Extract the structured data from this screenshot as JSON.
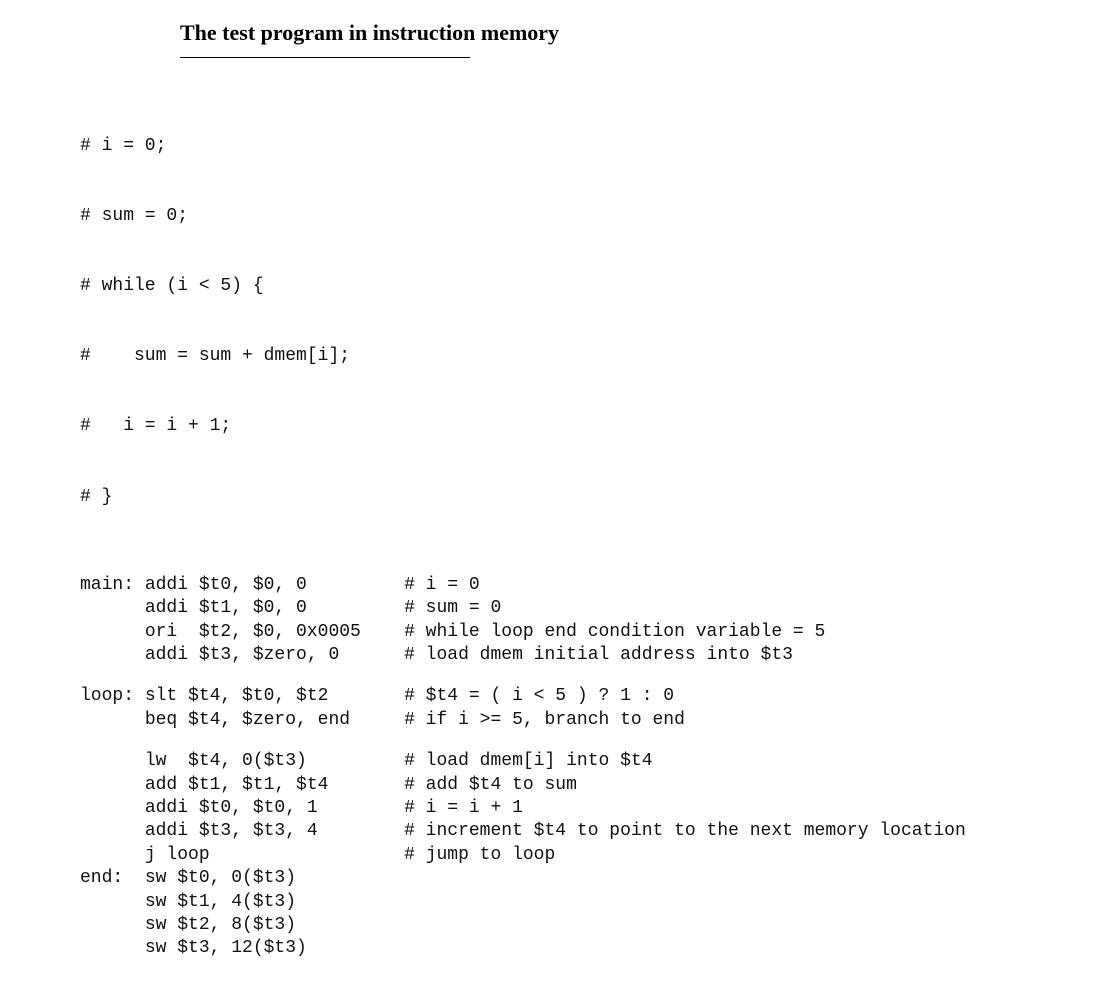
{
  "title": "The test program in instruction memory",
  "pseudo": [
    "# i = 0;",
    "# sum = 0;",
    "# while (i < 5) {",
    "#    sum = sum + dmem[i];",
    "#   i = i + 1;",
    "# }"
  ],
  "asm": [
    {
      "label": "main:",
      "instr": "addi $t0, $0, 0",
      "comment": "# i = 0"
    },
    {
      "label": "",
      "instr": "addi $t1, $0, 0",
      "comment": "# sum = 0"
    },
    {
      "label": "",
      "instr": "ori  $t2, $0, 0x0005",
      "comment": "# while loop end condition variable = 5"
    },
    {
      "label": "",
      "instr": "addi $t3, $zero, 0",
      "comment": "# load dmem initial address into $t3"
    },
    {
      "label": "SPACER"
    },
    {
      "label": "loop:",
      "instr": "slt $t4, $t0, $t2",
      "comment": "# $t4 = ( i < 5 ) ? 1 : 0"
    },
    {
      "label": "",
      "instr": "beq $t4, $zero, end",
      "comment": "# if i >= 5, branch to end"
    },
    {
      "label": "SPACER"
    },
    {
      "label": "",
      "instr": "lw  $t4, 0($t3)",
      "comment": "# load dmem[i] into $t4"
    },
    {
      "label": "",
      "instr": "add $t1, $t1, $t4",
      "comment": "# add $t4 to sum"
    },
    {
      "label": "",
      "instr": "addi $t0, $t0, 1",
      "comment": "# i = i + 1"
    },
    {
      "label": "",
      "instr": "addi $t3, $t3, 4",
      "comment": "# increment $t4 to point to the next memory location"
    },
    {
      "label": "",
      "instr": "j loop",
      "comment": "# jump to loop"
    },
    {
      "label": "end:",
      "instr": "sw $t0, 0($t3)",
      "comment": ""
    },
    {
      "label": "",
      "instr": "sw $t1, 4($t3)",
      "comment": ""
    },
    {
      "label": "",
      "instr": "sw $t2, 8($t3)",
      "comment": ""
    },
    {
      "label": "",
      "instr": "sw $t3, 12($t3)",
      "comment": ""
    }
  ]
}
